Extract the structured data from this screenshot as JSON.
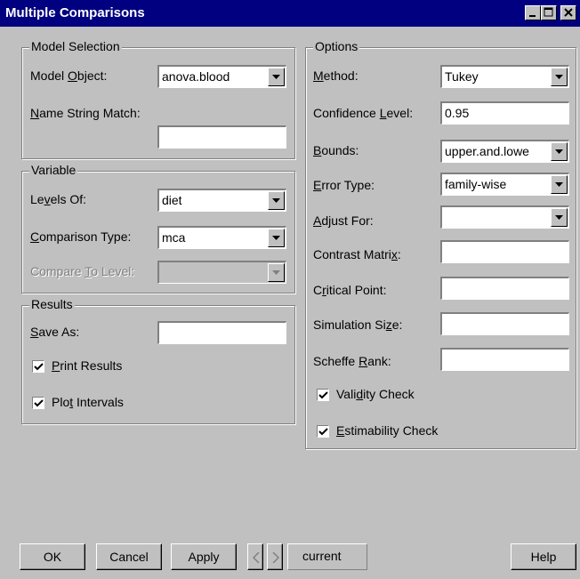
{
  "window": {
    "title": "Multiple Comparisons"
  },
  "model_selection": {
    "legend": "Model Selection",
    "model_object": {
      "label_pre": "Model ",
      "label_key": "O",
      "label_post": "bject:",
      "value": "anova.blood"
    },
    "name_string_match": {
      "label_pre": "",
      "label_key": "N",
      "label_post": "ame String Match:",
      "value": ""
    }
  },
  "variable": {
    "legend": "Variable",
    "levels_of": {
      "label_pre": "Le",
      "label_key": "v",
      "label_post": "els Of:",
      "value": "diet"
    },
    "comparison_type": {
      "label_pre": "",
      "label_key": "C",
      "label_post": "omparison Type:",
      "value": "mca"
    },
    "compare_to_level": {
      "label_pre": "Compare ",
      "label_key": "T",
      "label_post": "o Level:",
      "value": ""
    }
  },
  "results": {
    "legend": "Results",
    "save_as": {
      "label_pre": "",
      "label_key": "S",
      "label_post": "ave As:",
      "value": ""
    },
    "print_results": {
      "label_pre": "",
      "label_key": "P",
      "label_post": "rint Results",
      "checked": true
    },
    "plot_intervals": {
      "label_pre": "Plo",
      "label_key": "t",
      "label_post": " Intervals",
      "checked": true
    }
  },
  "options": {
    "legend": "Options",
    "method": {
      "label_pre": "",
      "label_key": "M",
      "label_post": "ethod:",
      "value": "Tukey"
    },
    "confidence_level": {
      "label_pre": "Confidence ",
      "label_key": "L",
      "label_post": "evel:",
      "value": "0.95"
    },
    "bounds": {
      "label_pre": "",
      "label_key": "B",
      "label_post": "ounds:",
      "value": "upper.and.lowe"
    },
    "error_type": {
      "label_pre": "",
      "label_key": "E",
      "label_post": "rror Type:",
      "value": "family-wise"
    },
    "adjust_for": {
      "label_pre": "",
      "label_key": "A",
      "label_post": "djust For:",
      "value": ""
    },
    "contrast_matrix": {
      "label_pre": "Contrast Matri",
      "label_key": "x",
      "label_post": ":",
      "value": ""
    },
    "critical_point": {
      "label_pre": "C",
      "label_key": "r",
      "label_post": "itical Point:",
      "value": ""
    },
    "simulation_size": {
      "label_pre": "Simulation Si",
      "label_key": "z",
      "label_post": "e:",
      "value": ""
    },
    "scheffe_rank": {
      "label_pre": "Scheffe ",
      "label_key": "R",
      "label_post": "ank:",
      "value": ""
    },
    "validity_check": {
      "label_pre": "Vali",
      "label_key": "d",
      "label_post": "ity Check",
      "checked": true
    },
    "estimability_check": {
      "label_pre": "",
      "label_key": "E",
      "label_post": "stimability Check",
      "checked": true
    }
  },
  "buttons": {
    "ok": "OK",
    "cancel": "Cancel",
    "apply": "Apply",
    "current": "current",
    "help": "Help"
  },
  "icons": {
    "minimize": "minimize-icon",
    "maximize": "maximize-icon",
    "close": "close-icon",
    "dropdown": "chevron-down-icon",
    "check": "check-icon",
    "prev": "chevron-left-icon",
    "next": "chevron-right-icon"
  }
}
